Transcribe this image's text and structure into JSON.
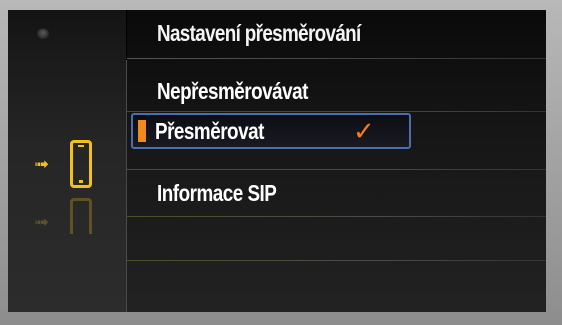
{
  "screen": {
    "title": "Nastavení přesměrování",
    "menu": [
      {
        "label": "Nepřesměrovávat",
        "selected": false
      },
      {
        "label": "Přesměrovat",
        "selected": true,
        "checked": true
      },
      {
        "label": "Informace SIP",
        "selected": false
      }
    ],
    "check_glyph": "✓"
  },
  "sidebar": {
    "icons": [
      "back-knob-icon",
      "call-forward-arrow-icon",
      "phone-icon"
    ],
    "arrow_glyph": "➟"
  },
  "colors": {
    "accent": "#f08a1c",
    "icon": "#f2c21a",
    "selection_border": "#4b6fa8",
    "text": "#ffffff"
  }
}
